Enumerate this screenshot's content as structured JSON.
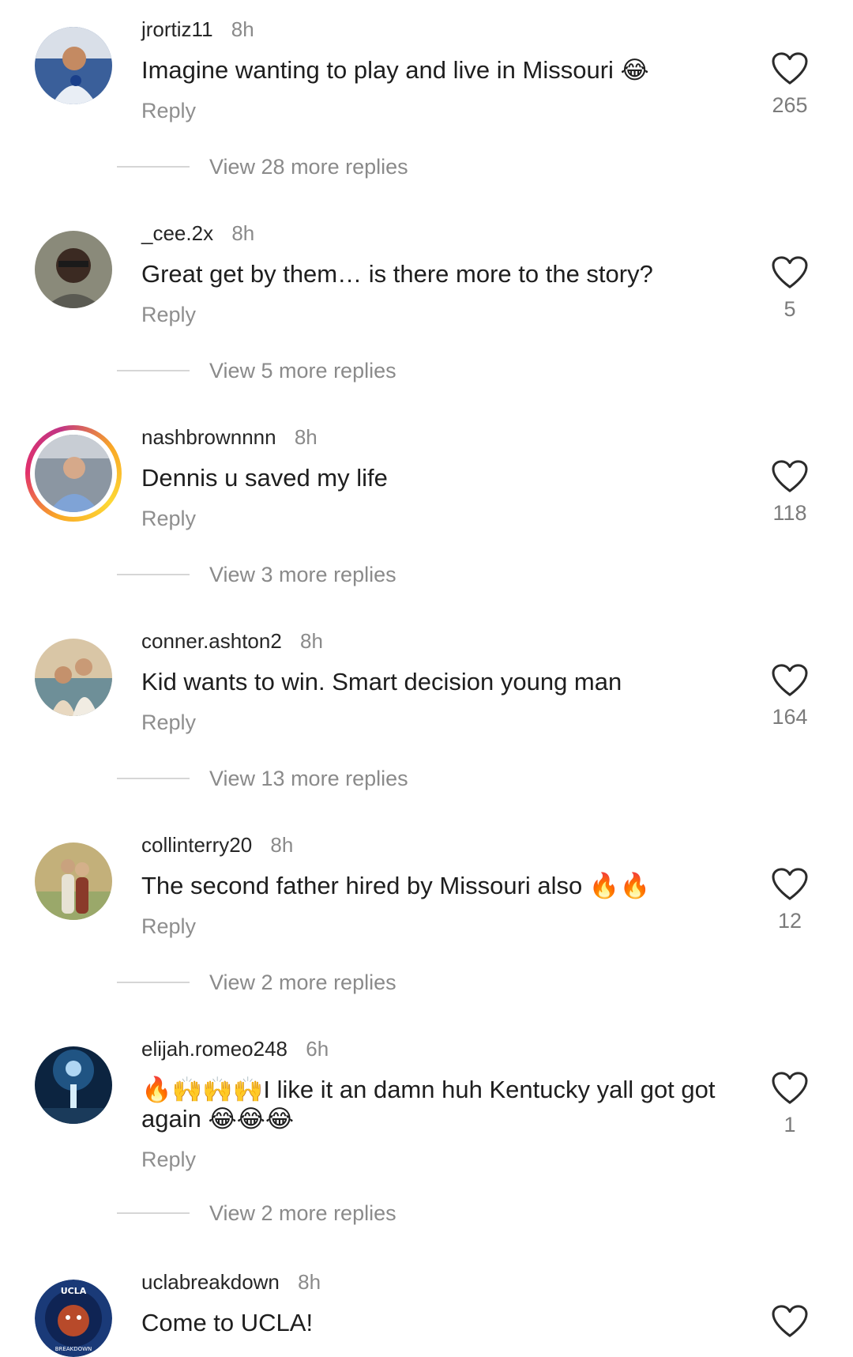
{
  "comments": [
    {
      "username": "jrortiz11",
      "time": "8h",
      "text": "Imagine wanting to play and live in Missouri 😂",
      "reply_label": "Reply",
      "likes": "265",
      "view_more": "View 28 more replies",
      "avatar_colors": {
        "bg": "#3a5f9a",
        "accent": "#c9d6e8"
      }
    },
    {
      "username": "_cee.2x",
      "time": "8h",
      "text": "Great get by them… is there more to the story?",
      "reply_label": "Reply",
      "likes": "5",
      "view_more": "View 5 more replies",
      "avatar_colors": {
        "bg": "#6a6a5c",
        "accent": "#3a2a22"
      }
    },
    {
      "username": "nashbrownnnn",
      "time": "8h",
      "text": "Dennis u saved my life",
      "reply_label": "Reply",
      "likes": "118",
      "view_more": "View 3 more replies",
      "avatar_colors": {
        "bg": "#9aa6b2",
        "accent": "#6a8fc4"
      }
    },
    {
      "username": "conner.ashton2",
      "time": "8h",
      "text": "Kid wants to win. Smart decision young man",
      "reply_label": "Reply",
      "likes": "164",
      "view_more": "View 13 more replies",
      "avatar_colors": {
        "bg": "#c9b79a",
        "accent": "#7a9aa8"
      }
    },
    {
      "username": "collinterry20",
      "time": "8h",
      "text": "The second father hired by Missouri also 🔥🔥",
      "reply_label": "Reply",
      "likes": "12",
      "view_more": "View 2 more replies",
      "avatar_colors": {
        "bg": "#b9a86a",
        "accent": "#8aa66a"
      }
    },
    {
      "username": "elijah.romeo248",
      "time": "6h",
      "text": "🔥🙌🙌🙌I like it an damn huh Kentucky yall got got again 😂😂😂",
      "reply_label": "Reply",
      "likes": "1",
      "view_more": "View 2 more replies",
      "avatar_colors": {
        "bg": "#0e2a4a",
        "accent": "#6ab0e0"
      }
    },
    {
      "username": "uclabreakdown",
      "time": "8h",
      "text": "Come to UCLA!",
      "reply_label": "",
      "likes": "",
      "view_more": "",
      "avatar_colors": {
        "bg": "#1a3a78",
        "accent": "#b84a2a"
      },
      "avatar_text": {
        "top": "UCLA",
        "bottom": "BREAKDOWN"
      }
    }
  ],
  "icons": {
    "like": "heart-outline-icon"
  }
}
